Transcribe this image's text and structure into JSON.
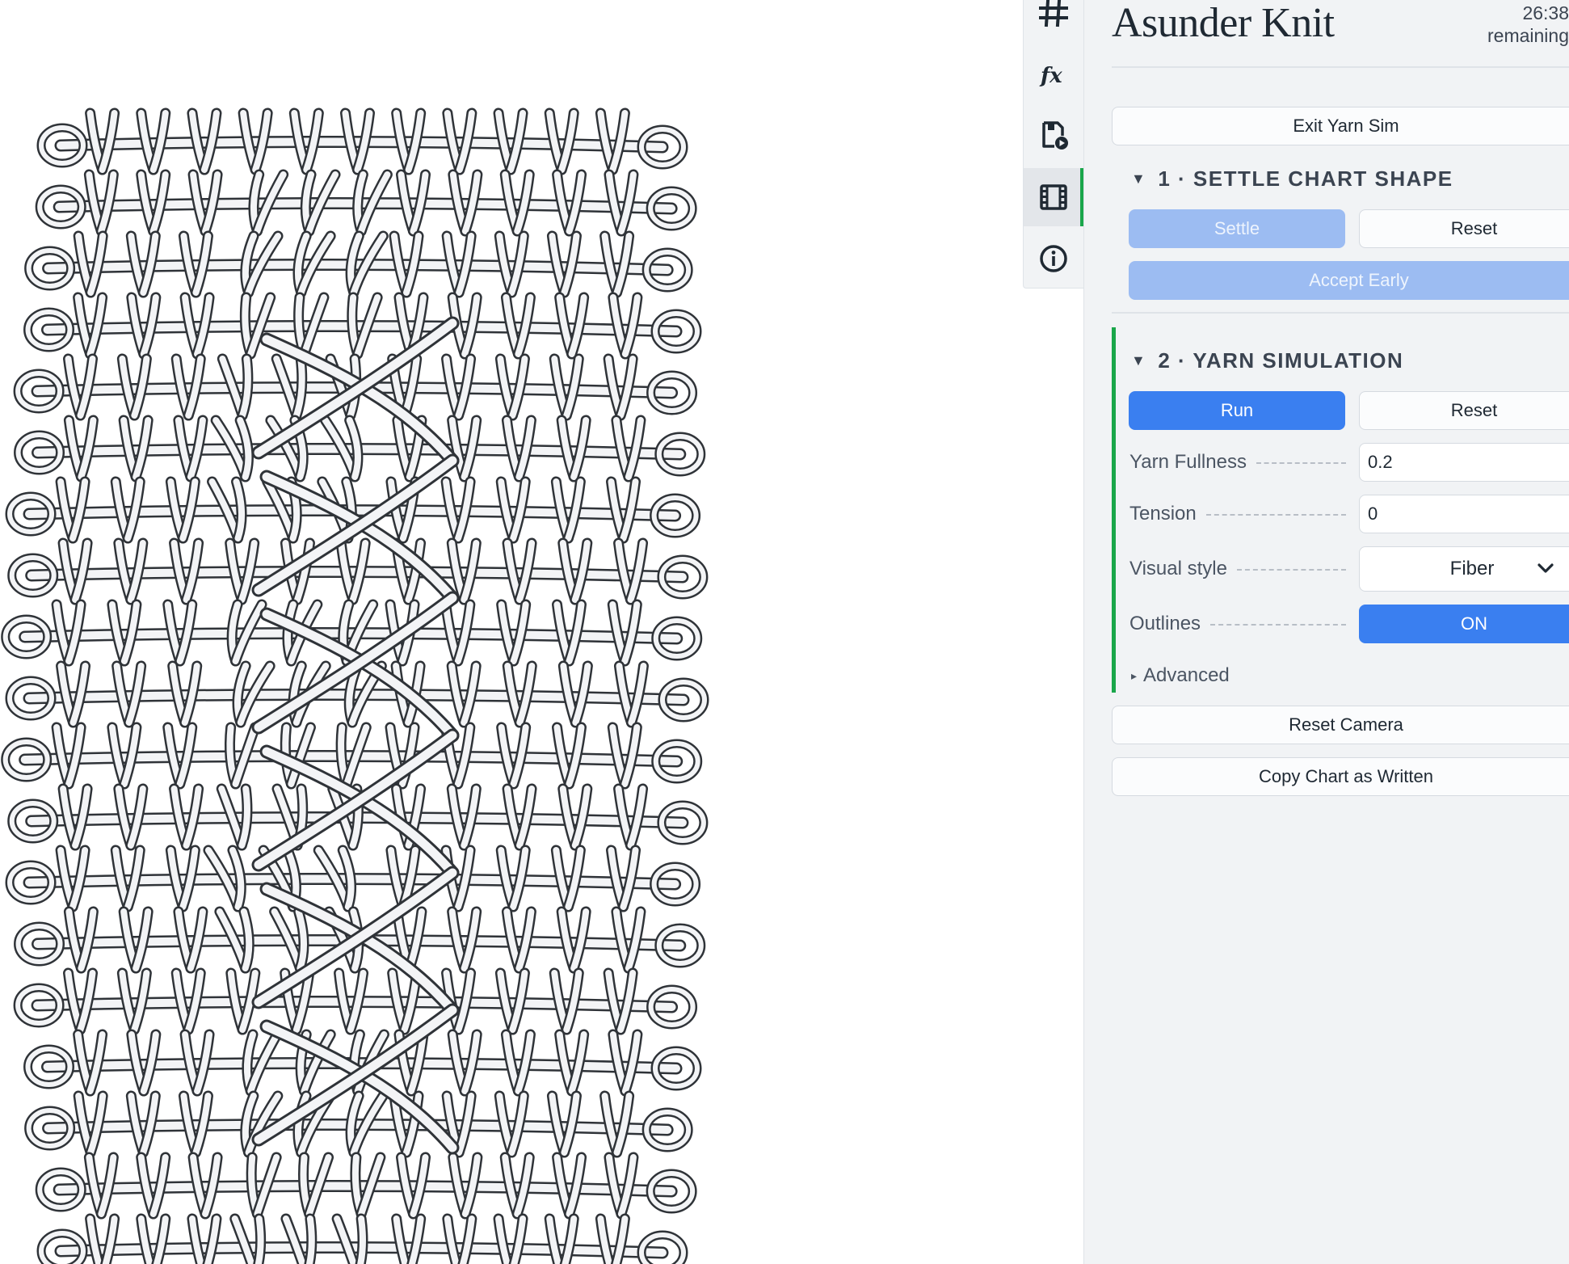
{
  "app": {
    "title": "Asunder Knit"
  },
  "timer": {
    "value": "26:38",
    "label": "remaining"
  },
  "toolbar": {
    "items": [
      {
        "icon": "grid-icon",
        "active": false
      },
      {
        "icon": "function-icon",
        "active": false
      },
      {
        "icon": "save-play-icon",
        "active": false
      },
      {
        "icon": "film-icon",
        "active": true
      },
      {
        "icon": "info-icon",
        "active": false
      }
    ]
  },
  "panel": {
    "exit_label": "Exit Yarn Sim",
    "settle": {
      "arrow": "▼",
      "heading": "1 · SETTLE CHART SHAPE",
      "settle_label": "Settle",
      "reset_label": "Reset",
      "accept_label": "Accept Early"
    },
    "sim": {
      "arrow": "▼",
      "heading": "2 · YARN SIMULATION",
      "run_label": "Run",
      "reset_label": "Reset",
      "fullness_label": "Yarn Fullness",
      "fullness_value": "0.2",
      "tension_label": "Tension",
      "tension_value": "0",
      "style_label": "Visual style",
      "style_value": "Fiber",
      "outlines_label": "Outlines",
      "outlines_value": "ON",
      "advanced_arrow": "▸",
      "advanced_label": "Advanced"
    },
    "reset_camera_label": "Reset Camera",
    "copy_chart_label": "Copy Chart as Written"
  },
  "colors": {
    "accent_blue": "#3a7ff0",
    "disabled_blue": "#9cbcf2",
    "accent_green": "#1aa64a",
    "panel_bg": "#f1f3f5",
    "yarn_fill": "#f3f4f6",
    "yarn_outline": "#2f3338"
  }
}
